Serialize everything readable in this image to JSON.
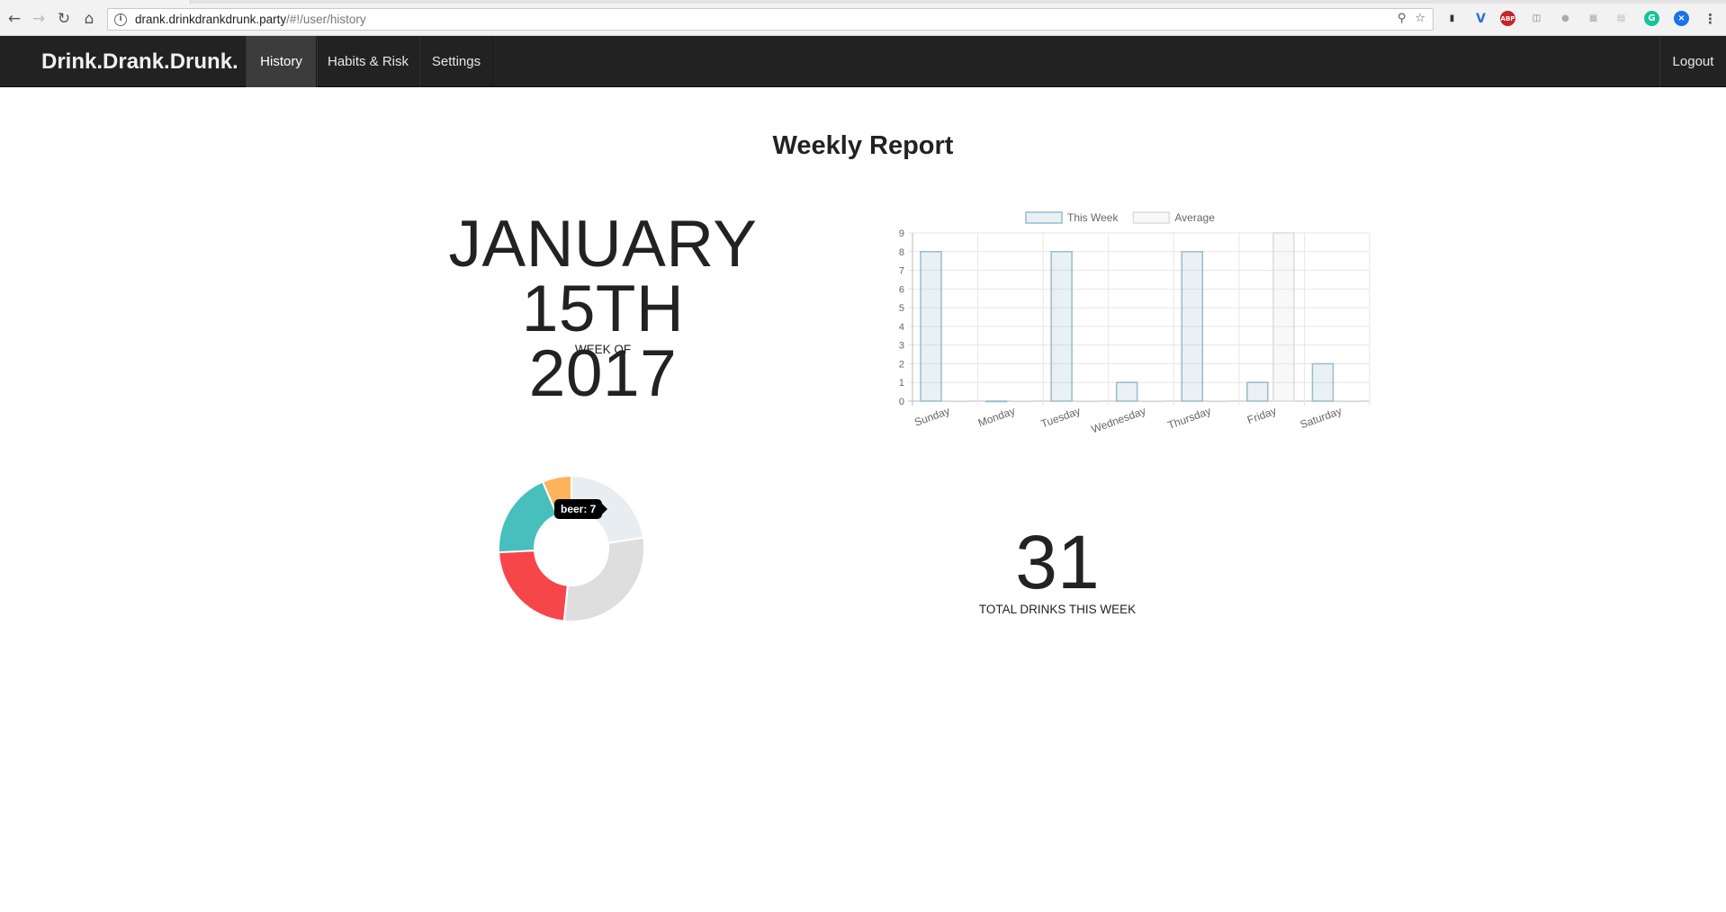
{
  "browser": {
    "url_host": "drank.drinkdrankdrunk.party",
    "url_path": "/#!/user/history",
    "abp_label": "ABP"
  },
  "navbar": {
    "brand": "Drink.Drank.Drunk.",
    "items": [
      {
        "label": "History",
        "active": true
      },
      {
        "label": "Habits & Risk",
        "active": false
      },
      {
        "label": "Settings",
        "active": false
      }
    ],
    "logout": "Logout"
  },
  "page": {
    "title": "Weekly Report",
    "date_line1": "JANUARY 15TH",
    "date_line2": "2017",
    "week_of": "WEEK OF",
    "total": "31",
    "total_label": "TOTAL DRINKS THIS WEEK"
  },
  "chart_data": [
    {
      "type": "bar",
      "categories": [
        "Sunday",
        "Monday",
        "Tuesday",
        "Wednesday",
        "Thursday",
        "Friday",
        "Saturday"
      ],
      "series": [
        {
          "name": "This Week",
          "values": [
            8,
            0,
            8,
            1,
            8,
            1,
            2
          ],
          "color": "#97bbcd"
        },
        {
          "name": "Average",
          "values": [
            0,
            0,
            0,
            0,
            0,
            9,
            0
          ],
          "color": "#dcdcdc"
        }
      ],
      "ylim": [
        0,
        9
      ],
      "yticks": [
        0,
        1,
        2,
        3,
        4,
        5,
        6,
        7,
        8,
        9
      ],
      "legend": "top-center",
      "grid": true
    },
    {
      "type": "pie",
      "donut": true,
      "slices": [
        {
          "value": 7,
          "color": "#e8edf2"
        },
        {
          "value": 9,
          "color": "#dedede"
        },
        {
          "value": 7,
          "color": "#f7464a"
        },
        {
          "value": 6,
          "color": "#46bfbd"
        },
        {
          "value": 2,
          "color": "#fdb45c"
        }
      ],
      "tooltip": "beer: 7"
    }
  ]
}
